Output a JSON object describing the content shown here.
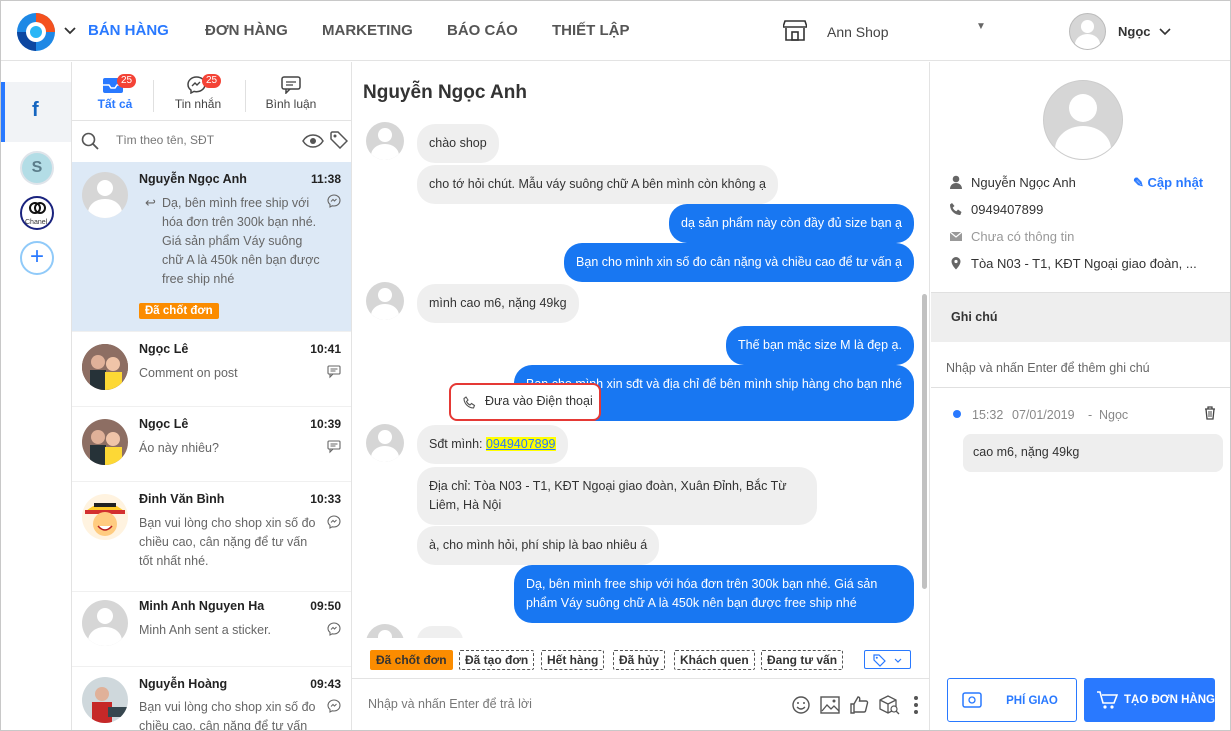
{
  "nav": {
    "items": [
      "BÁN HÀNG",
      "ĐƠN HÀNG",
      "MARKETING",
      "BÁO CÁO",
      "THIẾT LẬP"
    ],
    "shop": "Ann Shop",
    "user": "Ngọc"
  },
  "rail": {
    "fb_letter": "f",
    "s_letter": "S",
    "chanel_label": "Chanel"
  },
  "tabs": [
    {
      "label": "Tất cả",
      "badge": "25"
    },
    {
      "label": "Tin nhắn",
      "badge": "25"
    },
    {
      "label": "Bình luận"
    }
  ],
  "search": {
    "placeholder": "Tìm theo tên, SĐT"
  },
  "conversations": [
    {
      "name": "Nguyễn Ngọc Anh",
      "time": "11:38",
      "preview": "Dạ, bên mình free ship với hóa đơn trên 300k bạn nhé. Giá sản phẩm Váy suông chữ A là 450k nên bạn được free ship nhé",
      "tag": "Đã chốt đơn"
    },
    {
      "name": "Ngọc Lê",
      "time": "10:41",
      "preview": "Comment on post"
    },
    {
      "name": "Ngọc Lê",
      "time": "10:39",
      "preview": "Áo này nhiêu?"
    },
    {
      "name": "Đinh Văn Bình",
      "time": "10:33",
      "preview": "Bạn vui lòng cho shop xin số đo chiều cao, cân nặng để tư vấn tốt nhất nhé."
    },
    {
      "name": "Minh Anh Nguyen Ha",
      "time": "09:50",
      "preview": "Minh Anh sent a sticker."
    },
    {
      "name": "Nguyễn Hoàng",
      "time": "09:43",
      "preview": "Bạn vui lòng cho shop xin số đo chiều cao, cân nặng để tư vấn"
    }
  ],
  "chat": {
    "title": "Nguyễn Ngọc Anh",
    "messages": [
      {
        "dir": "in",
        "text": "chào shop"
      },
      {
        "dir": "in",
        "text": "cho tớ hỏi chút. Mẫu váy suông chữ A bên mình còn không ạ"
      },
      {
        "dir": "out",
        "text": "dạ sản phẩm này còn đầy đủ size bạn ạ"
      },
      {
        "dir": "out",
        "text": "Bạn cho mình xin số đo cân nặng và chiều cao để tư vấn ạ"
      },
      {
        "dir": "in",
        "text": "mình cao m6, nặng 49kg"
      },
      {
        "dir": "out",
        "text": "Thế bạn mặc size M là đẹp ạ."
      },
      {
        "dir": "out",
        "text": "Bạn cho mình xin sđt và địa chỉ để bên mình ship hàng cho bạn nhé"
      },
      {
        "dir": "in",
        "text_prefix": "Sđt mình: ",
        "phone": "0949407899"
      },
      {
        "dir": "in",
        "text": "Địa chỉ: Tòa N03 - T1, KĐT Ngoại giao đoàn, Xuân Đỉnh, Bắc Từ Liêm, Hà Nội"
      },
      {
        "dir": "in",
        "text": "à, cho mình hỏi, phí ship là bao nhiêu á"
      },
      {
        "dir": "out",
        "text": "Dạ, bên mình free ship với hóa đơn trên 300k bạn nhé. Giá sản phẩm Váy suông chữ A là 450k nên bạn được free ship nhé"
      }
    ],
    "tooltip": "Đưa vào Điện thoại",
    "quick_tags": [
      "Đã chốt đơn",
      "Đã tạo đơn",
      "Hết hàng",
      "Đã hủy",
      "Khách quen",
      "Đang tư vấn"
    ],
    "composer_placeholder": "Nhập và nhấn Enter để trả lời"
  },
  "customer": {
    "name": "Nguyễn Ngọc Anh",
    "update": "Cập nhật",
    "phone": "0949407899",
    "email": "Chưa có thông tin",
    "address": "Tòa N03 - T1, KĐT Ngoại giao đoàn, ...",
    "notes_title": "Ghi chú",
    "notes_placeholder": "Nhập và nhấn Enter để thêm ghi chú",
    "note": {
      "time": "15:32",
      "date": "07/01/2019",
      "sep": "-",
      "author": "Ngọc",
      "text": "cao m6, nặng 49kg"
    },
    "btn_shipping": "PHÍ GIAO HÀNG",
    "btn_order": "TẠO ĐƠN HÀNG"
  },
  "colors": {
    "accent": "#2979ff",
    "messenger": "#1877f2",
    "tag": "#fb8c00",
    "badge": "#f44336"
  }
}
